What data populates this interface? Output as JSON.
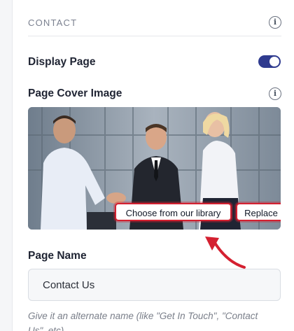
{
  "section": {
    "title": "CONTACT",
    "info_icon": "info-icon"
  },
  "display_page": {
    "label": "Display Page",
    "enabled": true,
    "toggle_color": "#2f3b8f"
  },
  "cover_image": {
    "label": "Page Cover Image",
    "info_icon": "info-icon",
    "library_button": "Choose from our library",
    "replace_button": "Replace",
    "highlight_color": "#d42030"
  },
  "page_name": {
    "label": "Page Name",
    "value": "Contact Us",
    "helper": "Give it an alternate name (like \"Get In Touch\", \"Contact Us\", etc)"
  }
}
